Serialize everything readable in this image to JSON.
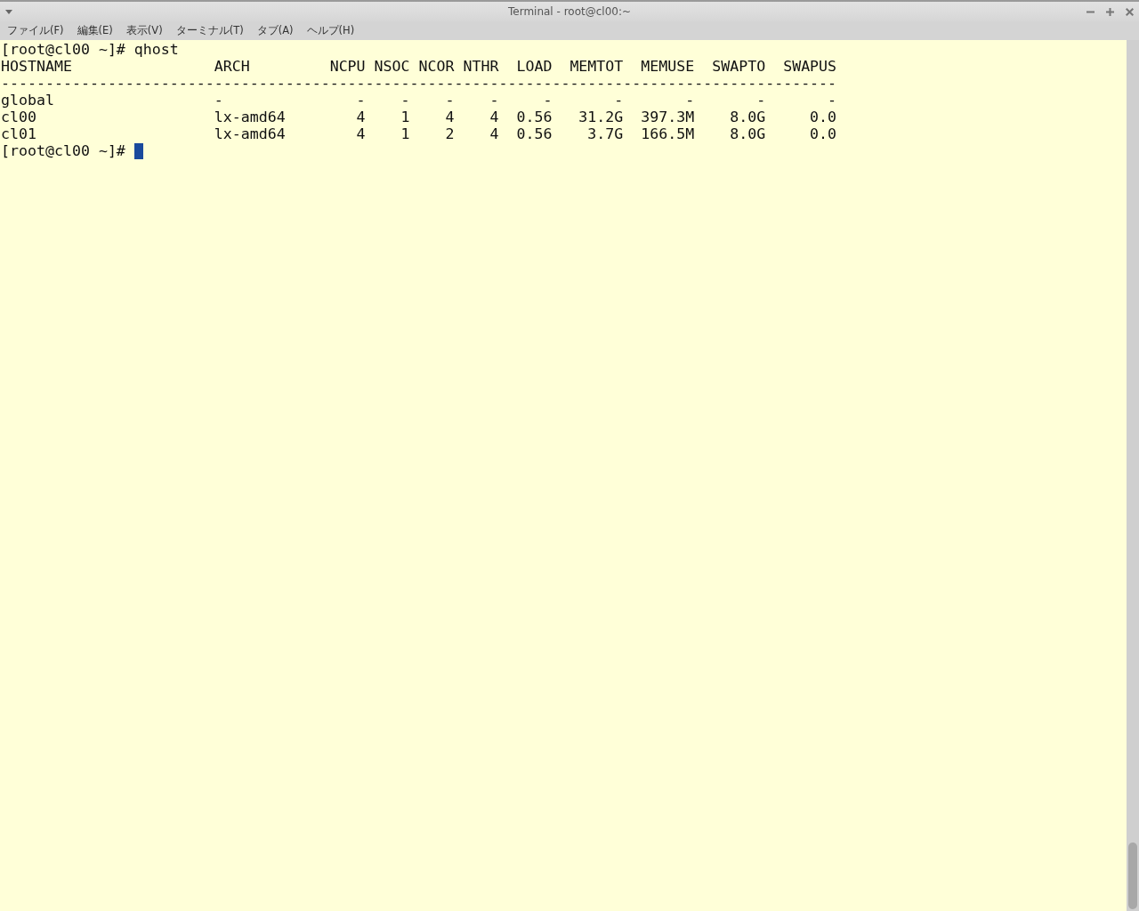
{
  "window": {
    "title": "Terminal - root@cl00:~"
  },
  "menu": [
    "ファイル(F)",
    "編集(E)",
    "表示(V)",
    "ターミナル(T)",
    "タブ(A)",
    "ヘルプ(H)"
  ],
  "terminal": {
    "lines": [
      "[root@cl00 ~]# qhost",
      "HOSTNAME                ARCH         NCPU NSOC NCOR NTHR  LOAD  MEMTOT  MEMUSE  SWAPTO  SWAPUS",
      "----------------------------------------------------------------------------------------------",
      "global                  -               -    -    -    -     -       -       -       -       -",
      "cl00                    lx-amd64        4    1    4    4  0.56   31.2G  397.3M    8.0G     0.0",
      "cl01                    lx-amd64        4    1    2    4  0.56    3.7G  166.5M    8.0G     0.0"
    ],
    "prompt": "[root@cl00 ~]# "
  }
}
